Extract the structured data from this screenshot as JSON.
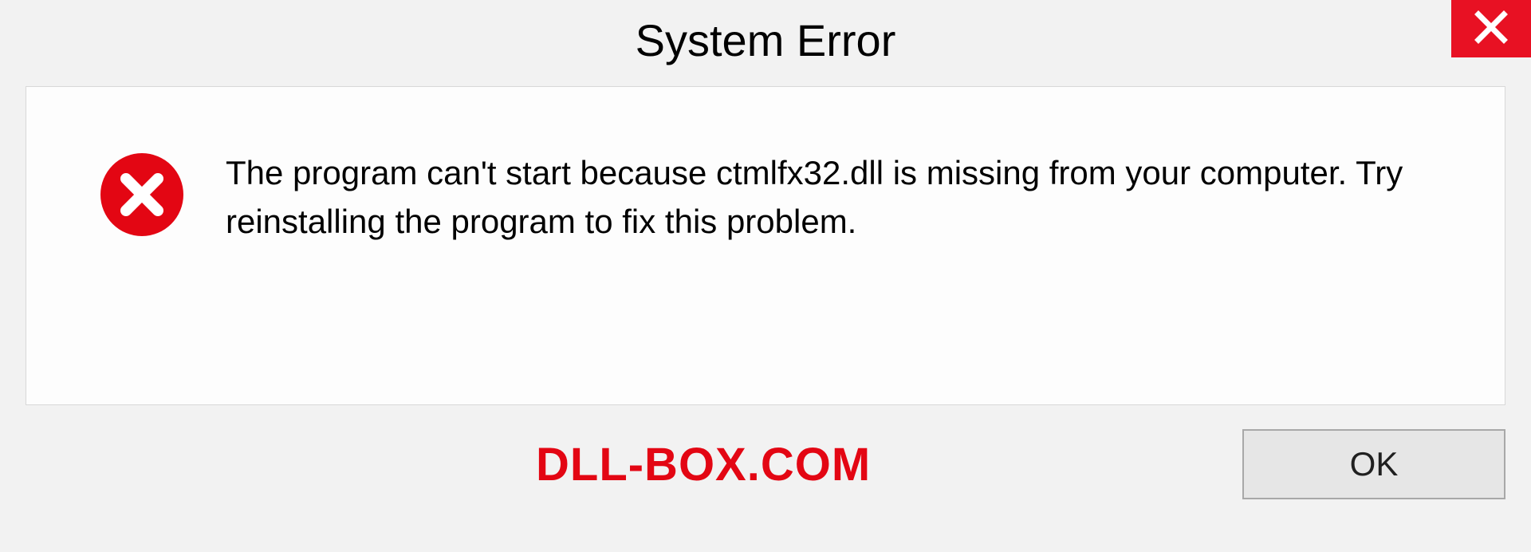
{
  "dialog": {
    "title": "System Error",
    "message": "The program can't start because ctmlfx32.dll is missing from your computer. Try reinstalling the program to fix this problem.",
    "ok_label": "OK"
  },
  "watermark": "DLL-BOX.COM"
}
